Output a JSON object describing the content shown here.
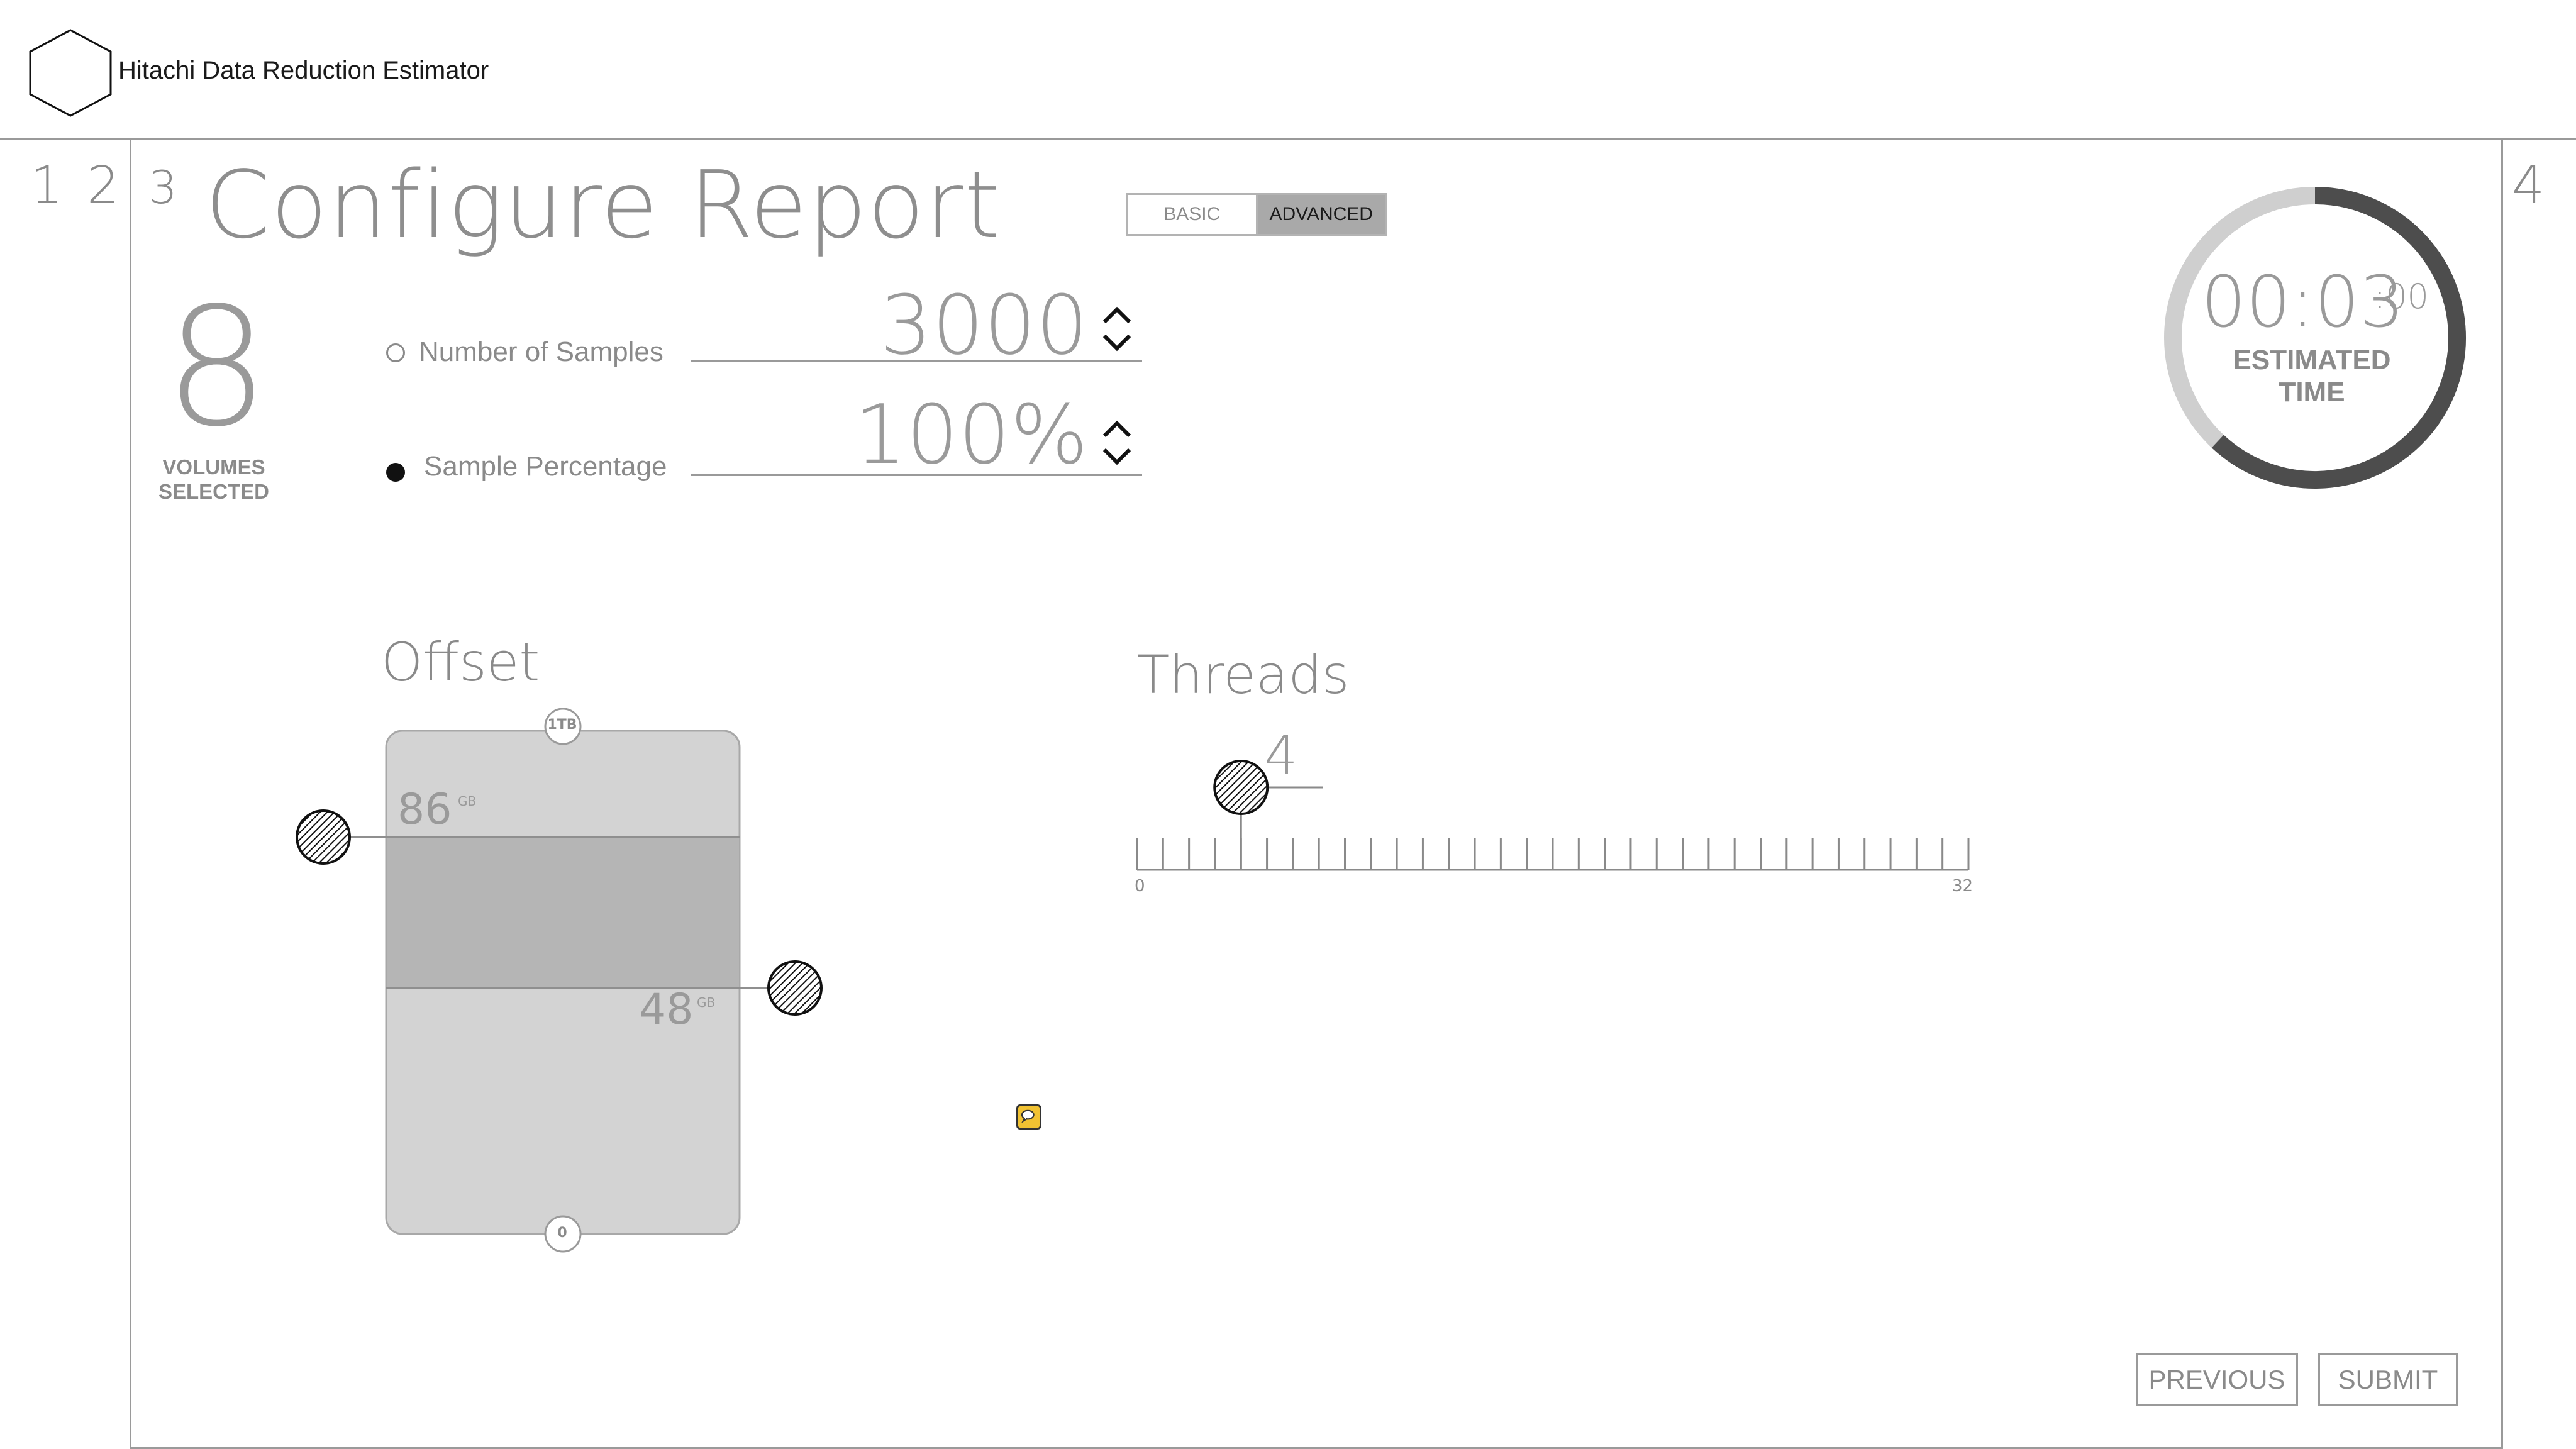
{
  "app": {
    "title": "Hitachi Data Reduction Estimator"
  },
  "steps": [
    "1",
    "2",
    "3",
    "4"
  ],
  "page": {
    "title": "Configure Report"
  },
  "mode_toggle": {
    "basic": "BASIC",
    "advanced": "ADVANCED",
    "selected": "ADVANCED"
  },
  "volumes": {
    "count": "8",
    "label_line1": "VOLUMES",
    "label_line2": "SELECTED"
  },
  "sampling": {
    "samples": {
      "label": "Number of Samples",
      "value": "3000",
      "selected": false
    },
    "percentage": {
      "label": "Sample Percentage",
      "value": "100%",
      "selected": true
    }
  },
  "offset": {
    "title": "Offset",
    "max_label": "1TB",
    "min_label": "0",
    "upper_value": "86",
    "lower_value": "48",
    "unit": "GB"
  },
  "threads": {
    "title": "Threads",
    "value": "4",
    "min": "0",
    "max": "32",
    "current": 4
  },
  "estimate": {
    "main": "00:03",
    "seconds": ":00",
    "label_line1": "ESTIMATED",
    "label_line2": "TIME",
    "progress": 0.62
  },
  "footer": {
    "previous": "PREVIOUS",
    "submit": "SUBMIT"
  },
  "icons": [
    "logo-hexagon-icon",
    "chevron-up-icon",
    "chevron-down-icon",
    "slider-handle-icon",
    "comment-icon"
  ],
  "colors": {
    "accent_dark": "#4d4d4d",
    "ring_light": "#cfcfcf",
    "offset_fill": "#d3d3d3",
    "offset_range": "#b5b5b5",
    "comment": "#f1c232"
  }
}
